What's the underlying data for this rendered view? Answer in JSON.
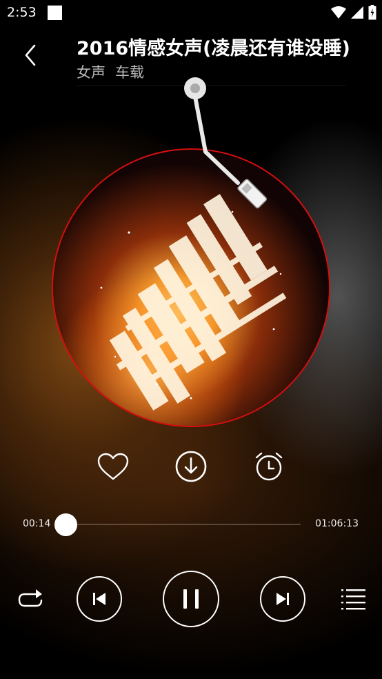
{
  "status_bar": {
    "time": "2:53"
  },
  "header": {
    "title": "2016情感女声(凌晨还有谁没睡)",
    "tags": [
      "女声",
      "车载"
    ]
  },
  "progress": {
    "current": "00:14",
    "total": "01:06:13",
    "fraction": 0.003
  },
  "playback": {
    "state": "playing"
  },
  "colors": {
    "disc_border": "#d80e0e",
    "tag_text": "#b8b8b8",
    "background": "#000000"
  },
  "icons": [
    "back-icon",
    "heart-icon",
    "download-icon",
    "alarm-clock-icon",
    "repeat-icon",
    "previous-icon",
    "pause-icon",
    "next-icon",
    "playlist-icon",
    "wifi-icon",
    "signal-icon",
    "battery-icon"
  ]
}
